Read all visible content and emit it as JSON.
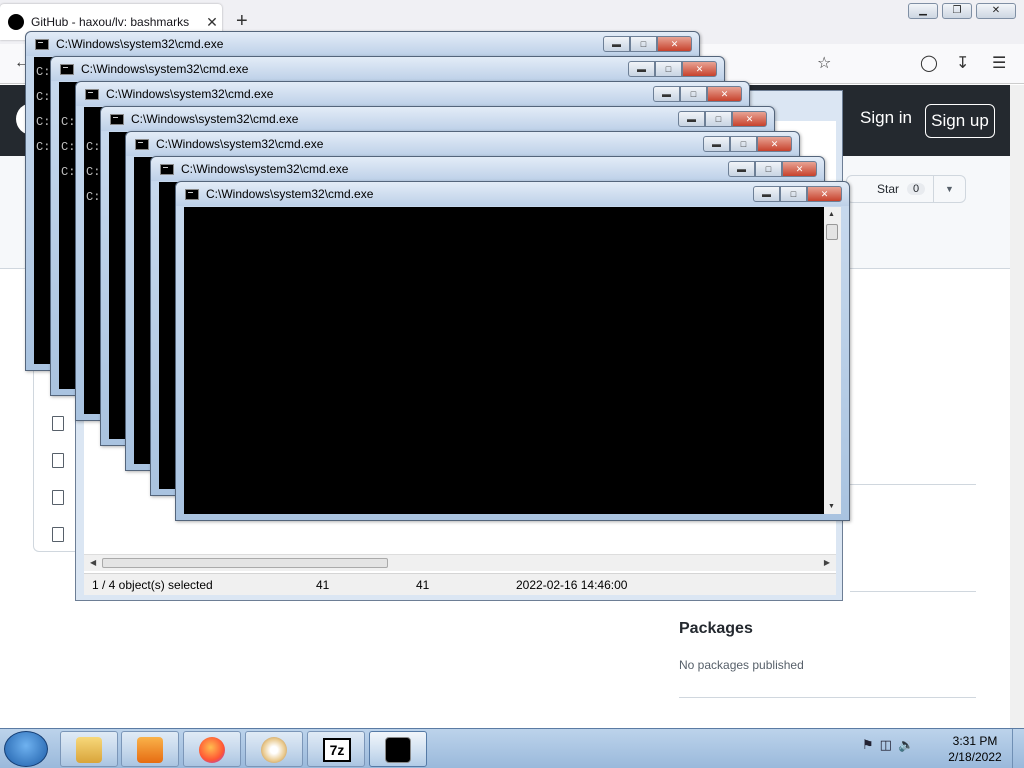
{
  "browser": {
    "tab_title": "GitHub - haxou/lv: bashmarks",
    "tab_close": "✕",
    "new_tab": "+",
    "window_buttons": {
      "minimize": "▁",
      "restore": "❐",
      "close": "✕"
    }
  },
  "github": {
    "sign_in": "Sign in",
    "sign_up": "Sign up",
    "star_label": "Star",
    "star_count": "0",
    "packages_title": "Packages",
    "packages_empty": "No packages published"
  },
  "explorer": {
    "status": {
      "selected": "1 / 4 object(s) selected",
      "size": "41",
      "packed": "41",
      "modified": "2022-02-16 14:46:00"
    }
  },
  "cmd_windows": [
    {
      "title": "C:\\Windows\\system32\\cmd.exe",
      "lines": "C:\\\nC:\\Us\nC:\\Us\nC:\\Us"
    },
    {
      "title": "C:\\Windows\\system32\\cmd.exe",
      "lines": "\nC:\\Us\nC:\\Us\nC:\\Us"
    },
    {
      "title": "C:\\Windows\\system32\\cmd.exe",
      "lines": "\nC:\\Us\nC:\\Us\nC:\\Us"
    },
    {
      "title": "C:\\Windows\\system32\\cmd.exe",
      "lines": ""
    },
    {
      "title": "C:\\Windows\\system32\\cmd.exe",
      "lines": ""
    },
    {
      "title": "C:\\Windows\\system32\\cmd.exe",
      "lines": ""
    },
    {
      "title": "C:\\Windows\\system32\\cmd.exe",
      "lines": ""
    }
  ],
  "cmd_buttons": {
    "minimize": "▬",
    "maximize": "□",
    "close": "✕"
  },
  "taskbar": {
    "time": "3:31 PM",
    "date": "2/18/2022",
    "sevenzip_label": "7z"
  }
}
